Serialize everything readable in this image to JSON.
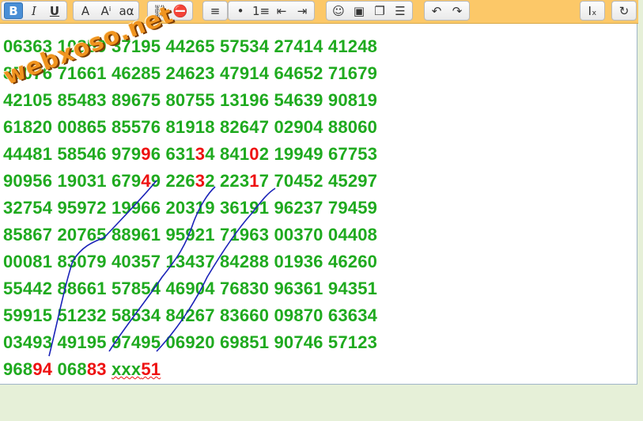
{
  "toolbar": {
    "groups": [
      {
        "buttons": [
          {
            "label": "B",
            "icon": "bold-icon"
          },
          {
            "label": "I",
            "icon": "italic-icon"
          },
          {
            "label": "U",
            "icon": "underline-icon"
          }
        ]
      },
      {
        "buttons": [
          {
            "label": "A",
            "icon": "font-color-icon"
          },
          {
            "label": "Aⁱ",
            "icon": "font-size-icon"
          },
          {
            "label": "aα",
            "icon": "special-char-icon"
          }
        ]
      },
      {
        "buttons": [
          {
            "label": "⛓",
            "icon": "link-icon"
          },
          {
            "label": "⛔",
            "icon": "unlink-icon"
          }
        ]
      },
      {
        "buttons": [
          {
            "label": "≡",
            "icon": "align-left-icon"
          }
        ]
      },
      {
        "buttons": [
          {
            "label": "•",
            "icon": "bulleted-list-icon"
          },
          {
            "label": "1≡",
            "icon": "numbered-list-icon"
          },
          {
            "label": "⇤",
            "icon": "outdent-icon"
          },
          {
            "label": "⇥",
            "icon": "indent-icon"
          }
        ]
      },
      {
        "buttons": [
          {
            "label": "☺",
            "icon": "smiley-icon"
          },
          {
            "label": "▣",
            "icon": "image-icon"
          },
          {
            "label": "❐",
            "icon": "gallery-icon"
          },
          {
            "label": "☰",
            "icon": "paste-icon"
          }
        ]
      },
      {
        "buttons": [
          {
            "label": "↶",
            "icon": "undo-icon"
          },
          {
            "label": "↷",
            "icon": "redo-icon"
          }
        ]
      },
      {
        "buttons": [
          {
            "label": "Iₓ",
            "icon": "remove-format-icon"
          }
        ]
      },
      {
        "buttons": [
          {
            "label": "↻",
            "icon": "source-icon"
          }
        ]
      }
    ]
  },
  "watermark": "webxoso.net",
  "lines": [
    [
      {
        "t": "06363 10859 37195 44265 57534 27414 41248"
      }
    ],
    [
      {
        "t": "85076 71661 46285 24623 47914 64652 71679"
      }
    ],
    [
      {
        "t": "42105 85483 89675 80755 13196 54639 90819"
      }
    ],
    [
      {
        "t": "61820 00865 85576 81918 82647 02904 88060"
      }
    ],
    [
      {
        "t": "44481 58546 979"
      },
      {
        "t": "9",
        "c": "red"
      },
      {
        "t": "6 631"
      },
      {
        "t": "3",
        "c": "red"
      },
      {
        "t": "4 841"
      },
      {
        "t": "0",
        "c": "red"
      },
      {
        "t": "2 19949 67753"
      }
    ],
    [
      {
        "t": "90956 19031 679"
      },
      {
        "t": "4",
        "c": "red"
      },
      {
        "t": "9 226"
      },
      {
        "t": "3",
        "c": "red"
      },
      {
        "t": "2 223"
      },
      {
        "t": "1",
        "c": "red"
      },
      {
        "t": "7 70452 45297"
      }
    ],
    [
      {
        "t": "32754 95972 19966 20319 36191 96237 79459"
      }
    ],
    [
      {
        "t": "85867 20765 88961 95921 71963 00370 04408"
      }
    ],
    [
      {
        "t": "00081 83079 40357 13437 84288 01936 46260"
      }
    ],
    [
      {
        "t": "55442 88661 57854 46904 76830 96361 94351"
      }
    ],
    [
      {
        "t": "59915 51232 58534 84267 83660 09870 63634"
      }
    ],
    [
      {
        "t": "03493 49195 97495 06920 69851 90746 57123"
      }
    ],
    [
      {
        "t": "968"
      },
      {
        "t": "94",
        "c": "red"
      },
      {
        "t": " 068"
      },
      {
        "t": "83",
        "c": "red"
      },
      {
        "t": " "
      },
      {
        "t": "xxx",
        "c": "green",
        "squig": true
      },
      {
        "t": "51",
        "c": "red",
        "squig": true
      }
    ]
  ]
}
